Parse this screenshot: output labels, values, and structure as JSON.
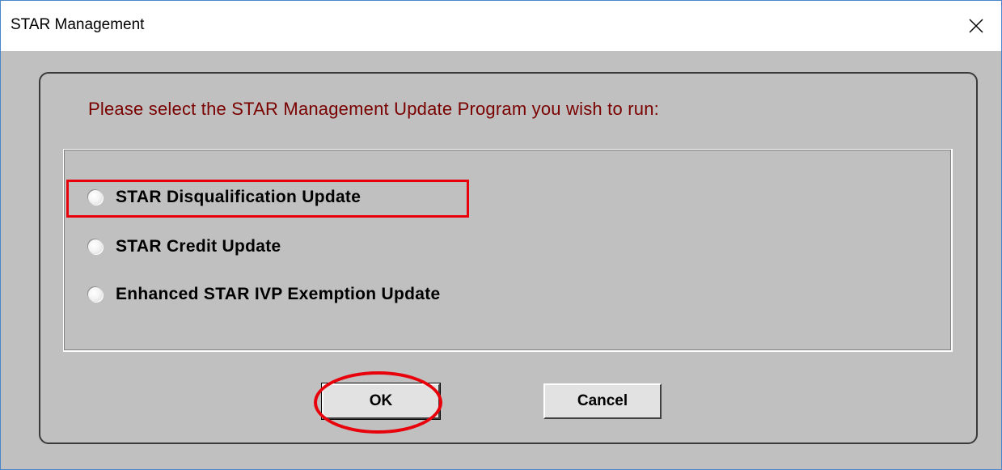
{
  "window": {
    "title": "STAR Management"
  },
  "dialog": {
    "prompt": "Please select the STAR Management Update Program you wish to run:",
    "options": [
      {
        "label": "STAR Disqualification Update",
        "selected": false
      },
      {
        "label": "STAR Credit Update",
        "selected": false
      },
      {
        "label": "Enhanced STAR IVP Exemption Update",
        "selected": false
      }
    ],
    "ok_label": "OK",
    "cancel_label": "Cancel"
  },
  "annotations": {
    "highlight_color": "#e8000b"
  },
  "colors": {
    "dialog_background": "#c0c0c0",
    "prompt_text": "#7a0000"
  },
  "icons": {
    "close": "close-icon",
    "radio": "radio-button-icon"
  }
}
